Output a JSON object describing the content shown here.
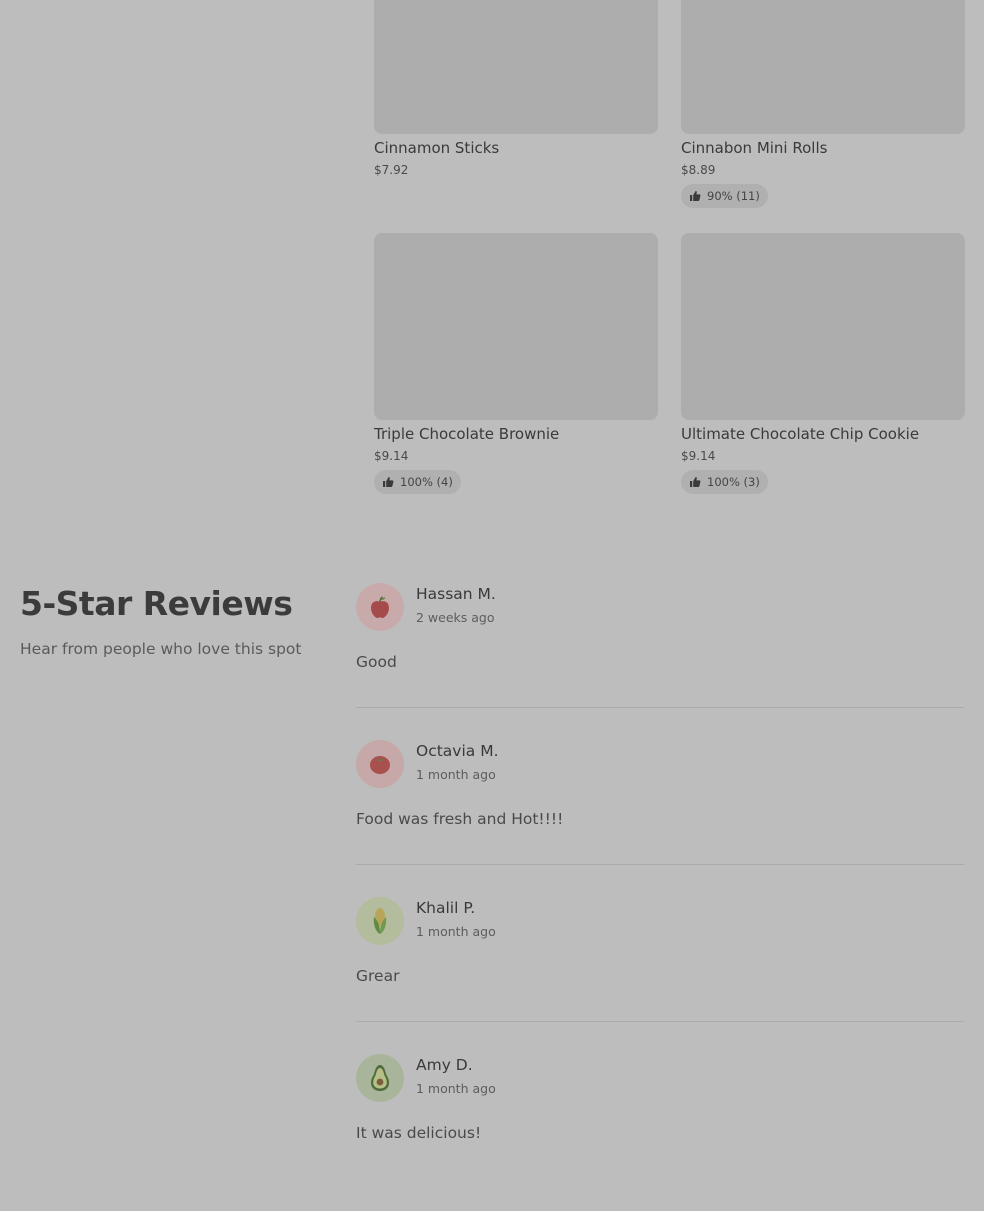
{
  "menu_items": [
    {
      "name": "Cinnamon Sticks",
      "price": "$7.92",
      "rating": null
    },
    {
      "name": "Cinnabon Mini Rolls",
      "price": "$8.89",
      "rating": "90% (11)"
    },
    {
      "name": "Triple Chocolate Brownie",
      "price": "$9.14",
      "rating": "100% (4)"
    },
    {
      "name": "Ultimate Chocolate Chip Cookie",
      "price": "$9.14",
      "rating": "100% (3)"
    }
  ],
  "reviews_section": {
    "title": "5-Star Reviews",
    "subtitle": "Hear from people who love this spot"
  },
  "reviews": [
    {
      "name": "Hassan M.",
      "date": "2 weeks ago",
      "text": "Good",
      "avatar": "apple-icon"
    },
    {
      "name": "Octavia M.",
      "date": "1 month ago",
      "text": "Food was fresh and Hot!!!!",
      "avatar": "tomato-icon"
    },
    {
      "name": "Khalil P.",
      "date": "1 month ago",
      "text": "Grear",
      "avatar": "corn-icon"
    },
    {
      "name": "Amy D.",
      "date": "1 month ago",
      "text": "It was delicious!",
      "avatar": "avocado-icon"
    }
  ],
  "colors": {
    "overlay_background": "#bdbdbd",
    "image_placeholder": "#adadad",
    "rating_pill": "#b0b0b0"
  }
}
